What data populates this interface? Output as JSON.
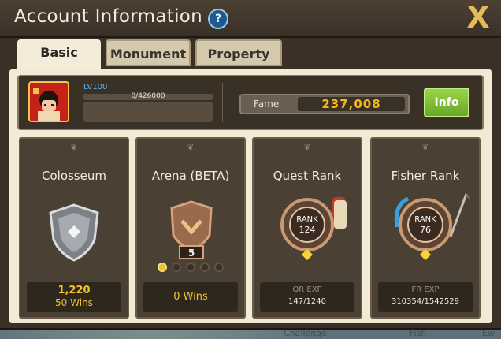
{
  "window": {
    "title": "Account Information",
    "help_symbol": "?",
    "close_symbol": "X"
  },
  "tabs": [
    {
      "label": "Basic",
      "active": true
    },
    {
      "label": "Monument",
      "active": false
    },
    {
      "label": "Property",
      "active": false
    }
  ],
  "profile": {
    "level": "LV100",
    "exp_text": "0/426000",
    "exp_progress": 0,
    "fame_label": "Fame",
    "fame_value": "237,008",
    "info_button": "Info"
  },
  "cards": {
    "colosseum": {
      "title": "Colosseum",
      "rating": "1,220",
      "wins": "50 Wins",
      "icon": "shield-icon"
    },
    "arena": {
      "title": "Arena (BETA)",
      "tier": "5",
      "wins": "0 Wins",
      "dots_filled": 1,
      "dots_total": 5,
      "icon": "bronze-shield-icon"
    },
    "quest": {
      "title": "Quest Rank",
      "rank_label": "RANK",
      "rank": "124",
      "exp_label": "QR EXP",
      "exp_value": "147/1240",
      "icon": "quest-rank-badge-icon"
    },
    "fisher": {
      "title": "Fisher Rank",
      "rank_label": "RANK",
      "rank": "76",
      "exp_label": "FR EXP",
      "exp_value": "310354/1542529",
      "icon": "fisher-rank-badge-icon"
    }
  },
  "background_labels": {
    "challenge": "Challenge",
    "fish": "Fish",
    "ew": "Ew"
  },
  "colors": {
    "accent_gold": "#f4c12c",
    "info_green": "#8bc83c",
    "level_blue": "#5ab6ff"
  }
}
